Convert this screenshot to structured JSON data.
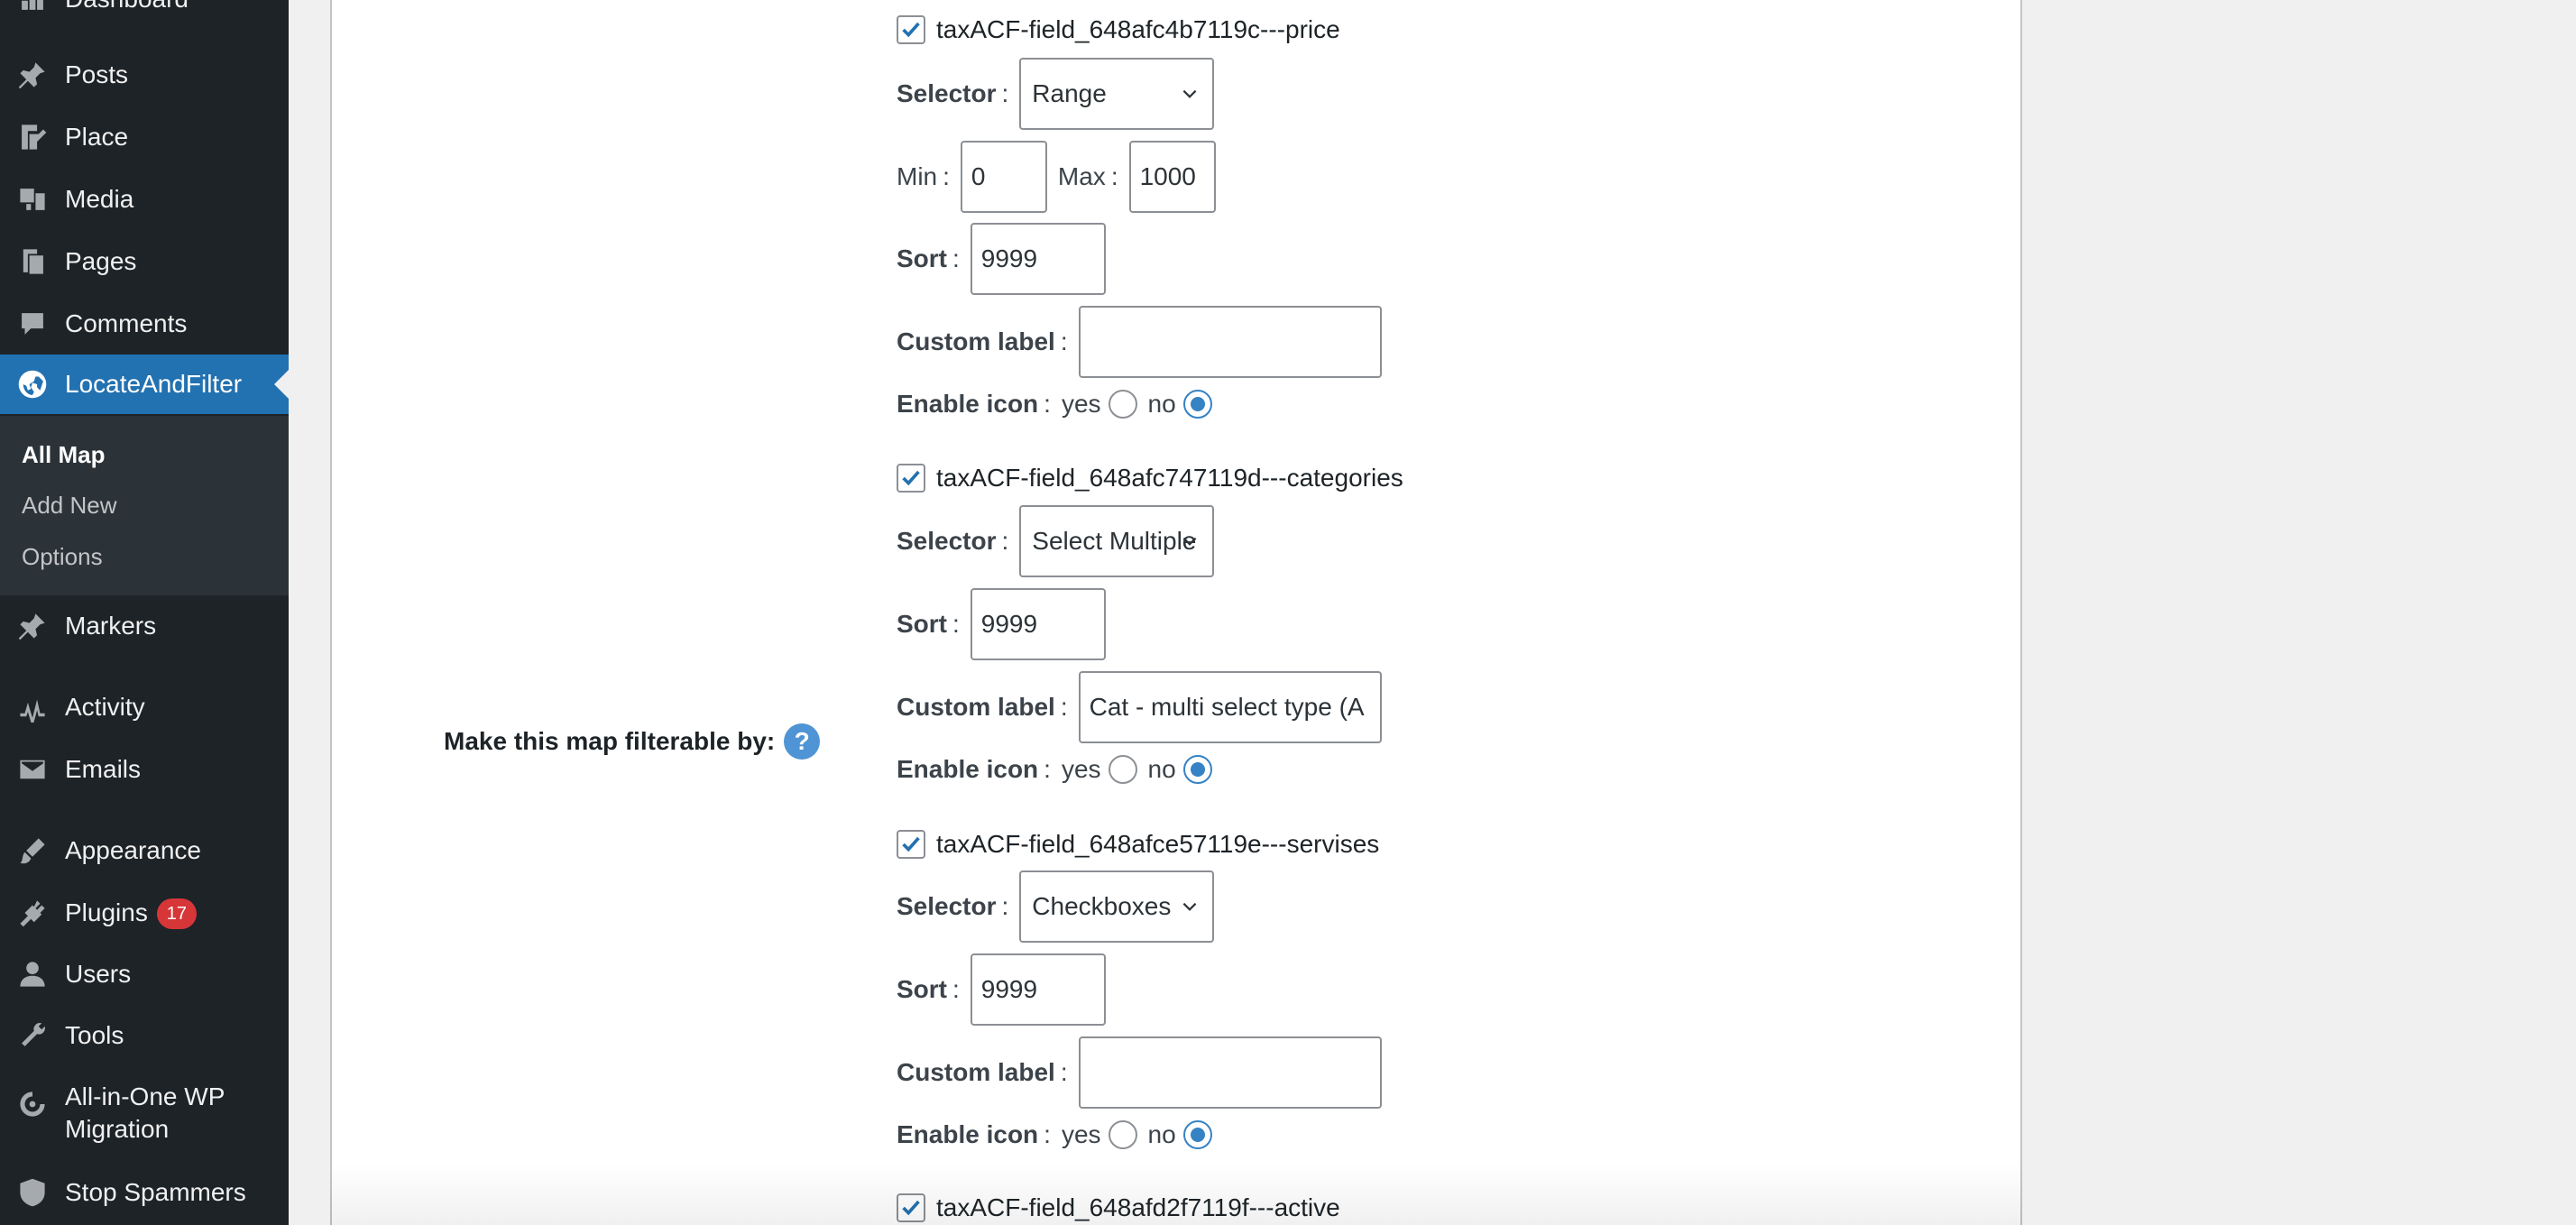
{
  "sidebar": {
    "items": [
      {
        "label": "Dashboard",
        "icon": "dashboard-icon"
      },
      {
        "label": "Posts",
        "icon": "pin-icon"
      },
      {
        "label": "Place",
        "icon": "edit-page-icon"
      },
      {
        "label": "Media",
        "icon": "media-icon"
      },
      {
        "label": "Pages",
        "icon": "pages-icon"
      },
      {
        "label": "Comments",
        "icon": "comment-icon"
      },
      {
        "label": "LocateAndFilter",
        "icon": "globe-icon"
      },
      {
        "label": "Markers",
        "icon": "pin-icon"
      },
      {
        "label": "Activity",
        "icon": "activity-icon"
      },
      {
        "label": "Emails",
        "icon": "email-icon"
      },
      {
        "label": "Appearance",
        "icon": "brush-icon"
      },
      {
        "label": "Plugins",
        "icon": "plugin-icon",
        "badge": "17"
      },
      {
        "label": "Users",
        "icon": "user-icon"
      },
      {
        "label": "Tools",
        "icon": "wrench-icon"
      },
      {
        "label": "All-in-One WP Migration",
        "icon": "migration-icon"
      },
      {
        "label": "Stop Spammers",
        "icon": "shield-icon"
      }
    ],
    "submenu": [
      "All Map",
      "Add New",
      "Options"
    ]
  },
  "main": {
    "row_label": "Make this map filterable by:",
    "help": "?",
    "labels": {
      "selector": "Selector",
      "min": "Min",
      "max": "Max",
      "sort": "Sort",
      "custom_label": "Custom label",
      "enable_icon": "Enable icon",
      "colon": ":",
      "yes": "yes",
      "no": "no"
    },
    "fields": [
      {
        "name": "taxACF-field_648afc4b7119c---price",
        "selector": "Range",
        "min": "0",
        "max": "1000",
        "sort": "9999",
        "custom_label": ""
      },
      {
        "name": "taxACF-field_648afc747119d---categories",
        "selector": "Select Multiple",
        "sort": "9999",
        "custom_label": "Cat - multi select type (A"
      },
      {
        "name": "taxACF-field_648afce57119e---servises",
        "selector": "Checkboxes",
        "sort": "9999",
        "custom_label": ""
      },
      {
        "name": "taxACF-field_648afd2f7119f---active"
      }
    ]
  }
}
